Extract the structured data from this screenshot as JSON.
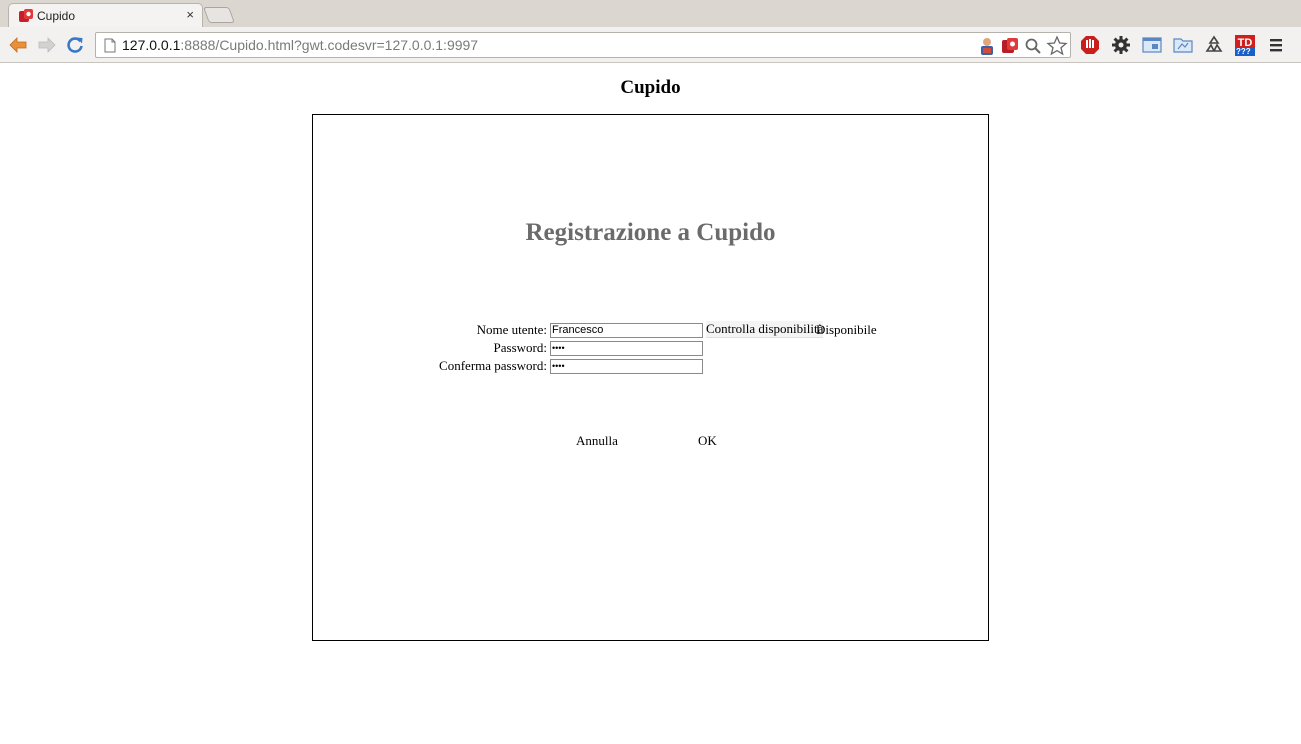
{
  "browser": {
    "tab_title": "Cupido",
    "tab_close": "×",
    "url_host": "127.0.0.1",
    "url_rest": ":8888/Cupido.html?gwt.codesvr=127.0.0.1:9997",
    "ext_badge": "???"
  },
  "page": {
    "title": "Cupido"
  },
  "form": {
    "heading": "Registrazione a Cupido",
    "username_label": "Nome utente:",
    "username_value": "Francesco",
    "password_label": "Password:",
    "password_value": "••••",
    "confirm_label": "Conferma password:",
    "confirm_value": "••••",
    "check_button": "Controlla disponibilità",
    "availability_status": "Disponibile",
    "cancel_label": "Annulla",
    "ok_label": "OK"
  },
  "colors": {
    "heading": "#6b6b6b",
    "nav_arrow": "#e8913a",
    "reload": "#3a78c8",
    "favicon_red": "#c8202a"
  }
}
